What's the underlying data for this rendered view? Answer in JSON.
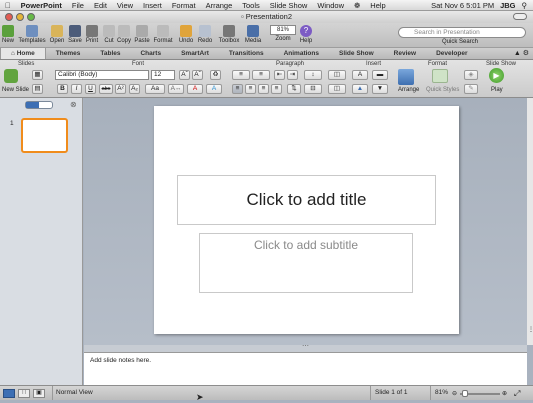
{
  "menubar": {
    "items": [
      "PowerPoint",
      "File",
      "Edit",
      "View",
      "Insert",
      "Format",
      "Arrange",
      "Tools",
      "Slide Show",
      "Window",
      "Help"
    ],
    "datetime": "Sat Nov 6  5:01 PM",
    "user": "JBG"
  },
  "window": {
    "title": "Presentation2"
  },
  "toolbar": {
    "buttons": [
      "New",
      "Templates",
      "Open",
      "Save",
      "Print",
      "Cut",
      "Copy",
      "Paste",
      "Format",
      "Undo",
      "Redo",
      "Toolbox",
      "Media",
      "Zoom",
      "Help"
    ],
    "zoom_value": "81%",
    "search_placeholder": "Search in Presentation",
    "search_label": "Quick Search"
  },
  "ribbon": {
    "tabs": [
      "Home",
      "Themes",
      "Tables",
      "Charts",
      "SmartArt",
      "Transitions",
      "Animations",
      "Slide Show",
      "Review",
      "Developer"
    ],
    "groups": [
      "Slides",
      "Font",
      "Paragraph",
      "Insert",
      "Format",
      "Slide Show"
    ],
    "new_slide_label": "New Slide",
    "font_name": "Calibri (Body)",
    "font_size": "12",
    "arrange_label": "Arrange",
    "quick_styles_label": "Quick Styles",
    "play_label": "Play"
  },
  "slides_pane": {
    "slide_number": "1"
  },
  "slide": {
    "title_placeholder": "Click to add title",
    "subtitle_placeholder": "Click to add subtitle"
  },
  "notes": {
    "placeholder": "Add slide notes here."
  },
  "statusbar": {
    "view": "Normal View",
    "slide_info": "Slide 1 of 1",
    "zoom": "81%"
  }
}
